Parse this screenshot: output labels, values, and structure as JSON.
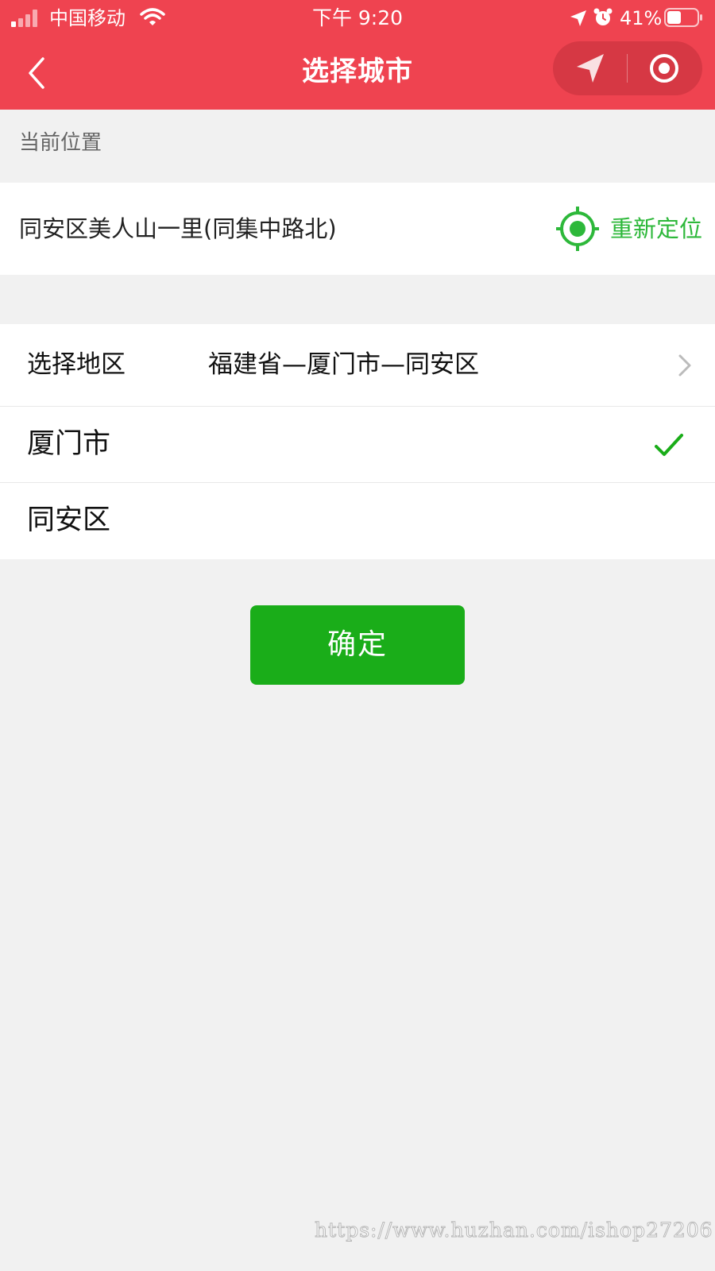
{
  "status_bar": {
    "carrier": "中国移动",
    "time": "下午 9:20",
    "battery": "41%"
  },
  "nav": {
    "title": "选择城市"
  },
  "current_location": {
    "label": "当前位置",
    "address": "同安区美人山一里(同集中路北)",
    "relocate_label": "重新定位"
  },
  "selection": {
    "region_label": "选择地区",
    "region_value": "福建省—厦门市—同安区",
    "city": "厦门市",
    "district": "同安区"
  },
  "confirm": {
    "label": "确定"
  },
  "watermark": "https://www.huzhan.com/ishop27206",
  "colors": {
    "header": "#ef4350",
    "accent_green": "#2db83a",
    "button_green": "#1aad19",
    "background": "#f1f1f1"
  },
  "icons": {
    "back": "chevron-left-icon",
    "navigate": "navigation-arrow-icon",
    "target": "target-icon",
    "chevron": "chevron-right-icon",
    "check": "check-icon"
  }
}
